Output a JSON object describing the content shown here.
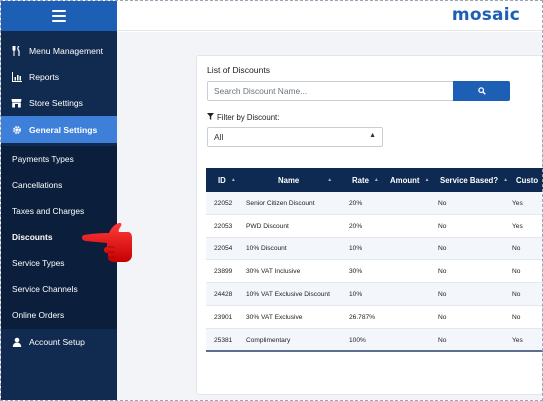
{
  "app": {
    "logo": "mosaic",
    "brand_color": "#1e5fb6"
  },
  "sidebar": {
    "menu_icon": "hamburger-menu-icon",
    "items": [
      {
        "label": "Menu Management",
        "icon": "utensils-icon"
      },
      {
        "label": "Reports",
        "icon": "bar-chart-icon"
      },
      {
        "label": "Store Settings",
        "icon": "store-icon"
      },
      {
        "label": "General Settings",
        "icon": "gear-icon",
        "active": true
      }
    ],
    "sub_items": [
      {
        "label": "Payments Types"
      },
      {
        "label": "Cancellations"
      },
      {
        "label": "Taxes and Charges"
      },
      {
        "label": "Discounts",
        "selected": true
      },
      {
        "label": "Service Types"
      },
      {
        "label": "Service Channels"
      },
      {
        "label": "Online Orders"
      }
    ],
    "bottom_items": [
      {
        "label": "Account Setup",
        "icon": "user-icon"
      }
    ]
  },
  "main": {
    "title": "List of Discounts",
    "search": {
      "placeholder": "Search Discount Name...",
      "value": ""
    },
    "filter": {
      "label": "Filter by Discount:",
      "selected": "All"
    },
    "table": {
      "columns": [
        "ID",
        "Name",
        "Rate",
        "Amount",
        "Service Based?",
        "Custo"
      ],
      "rows": [
        {
          "id": "22052",
          "name": "Senior Citizen Discount",
          "rate": "20%",
          "amount": "",
          "service_based": "No",
          "custom": "Yes"
        },
        {
          "id": "22053",
          "name": "PWD Discount",
          "rate": "20%",
          "amount": "",
          "service_based": "No",
          "custom": "Yes"
        },
        {
          "id": "22054",
          "name": "10% Discount",
          "rate": "10%",
          "amount": "",
          "service_based": "No",
          "custom": "No"
        },
        {
          "id": "23899",
          "name": "30% VAT Inclusive",
          "rate": "30%",
          "amount": "",
          "service_based": "No",
          "custom": "No"
        },
        {
          "id": "24428",
          "name": "10% VAT Exclusive Discount",
          "rate": "10%",
          "amount": "",
          "service_based": "No",
          "custom": "No"
        },
        {
          "id": "23901",
          "name": "30% VAT Exclusive",
          "rate": "26.787%",
          "amount": "",
          "service_based": "No",
          "custom": "No"
        },
        {
          "id": "25381",
          "name": "Complimentary",
          "rate": "100%",
          "amount": "",
          "service_based": "No",
          "custom": "Yes"
        }
      ]
    }
  },
  "annotation": {
    "pointer": "red-pointing-hand-icon",
    "color": "#e01010"
  }
}
